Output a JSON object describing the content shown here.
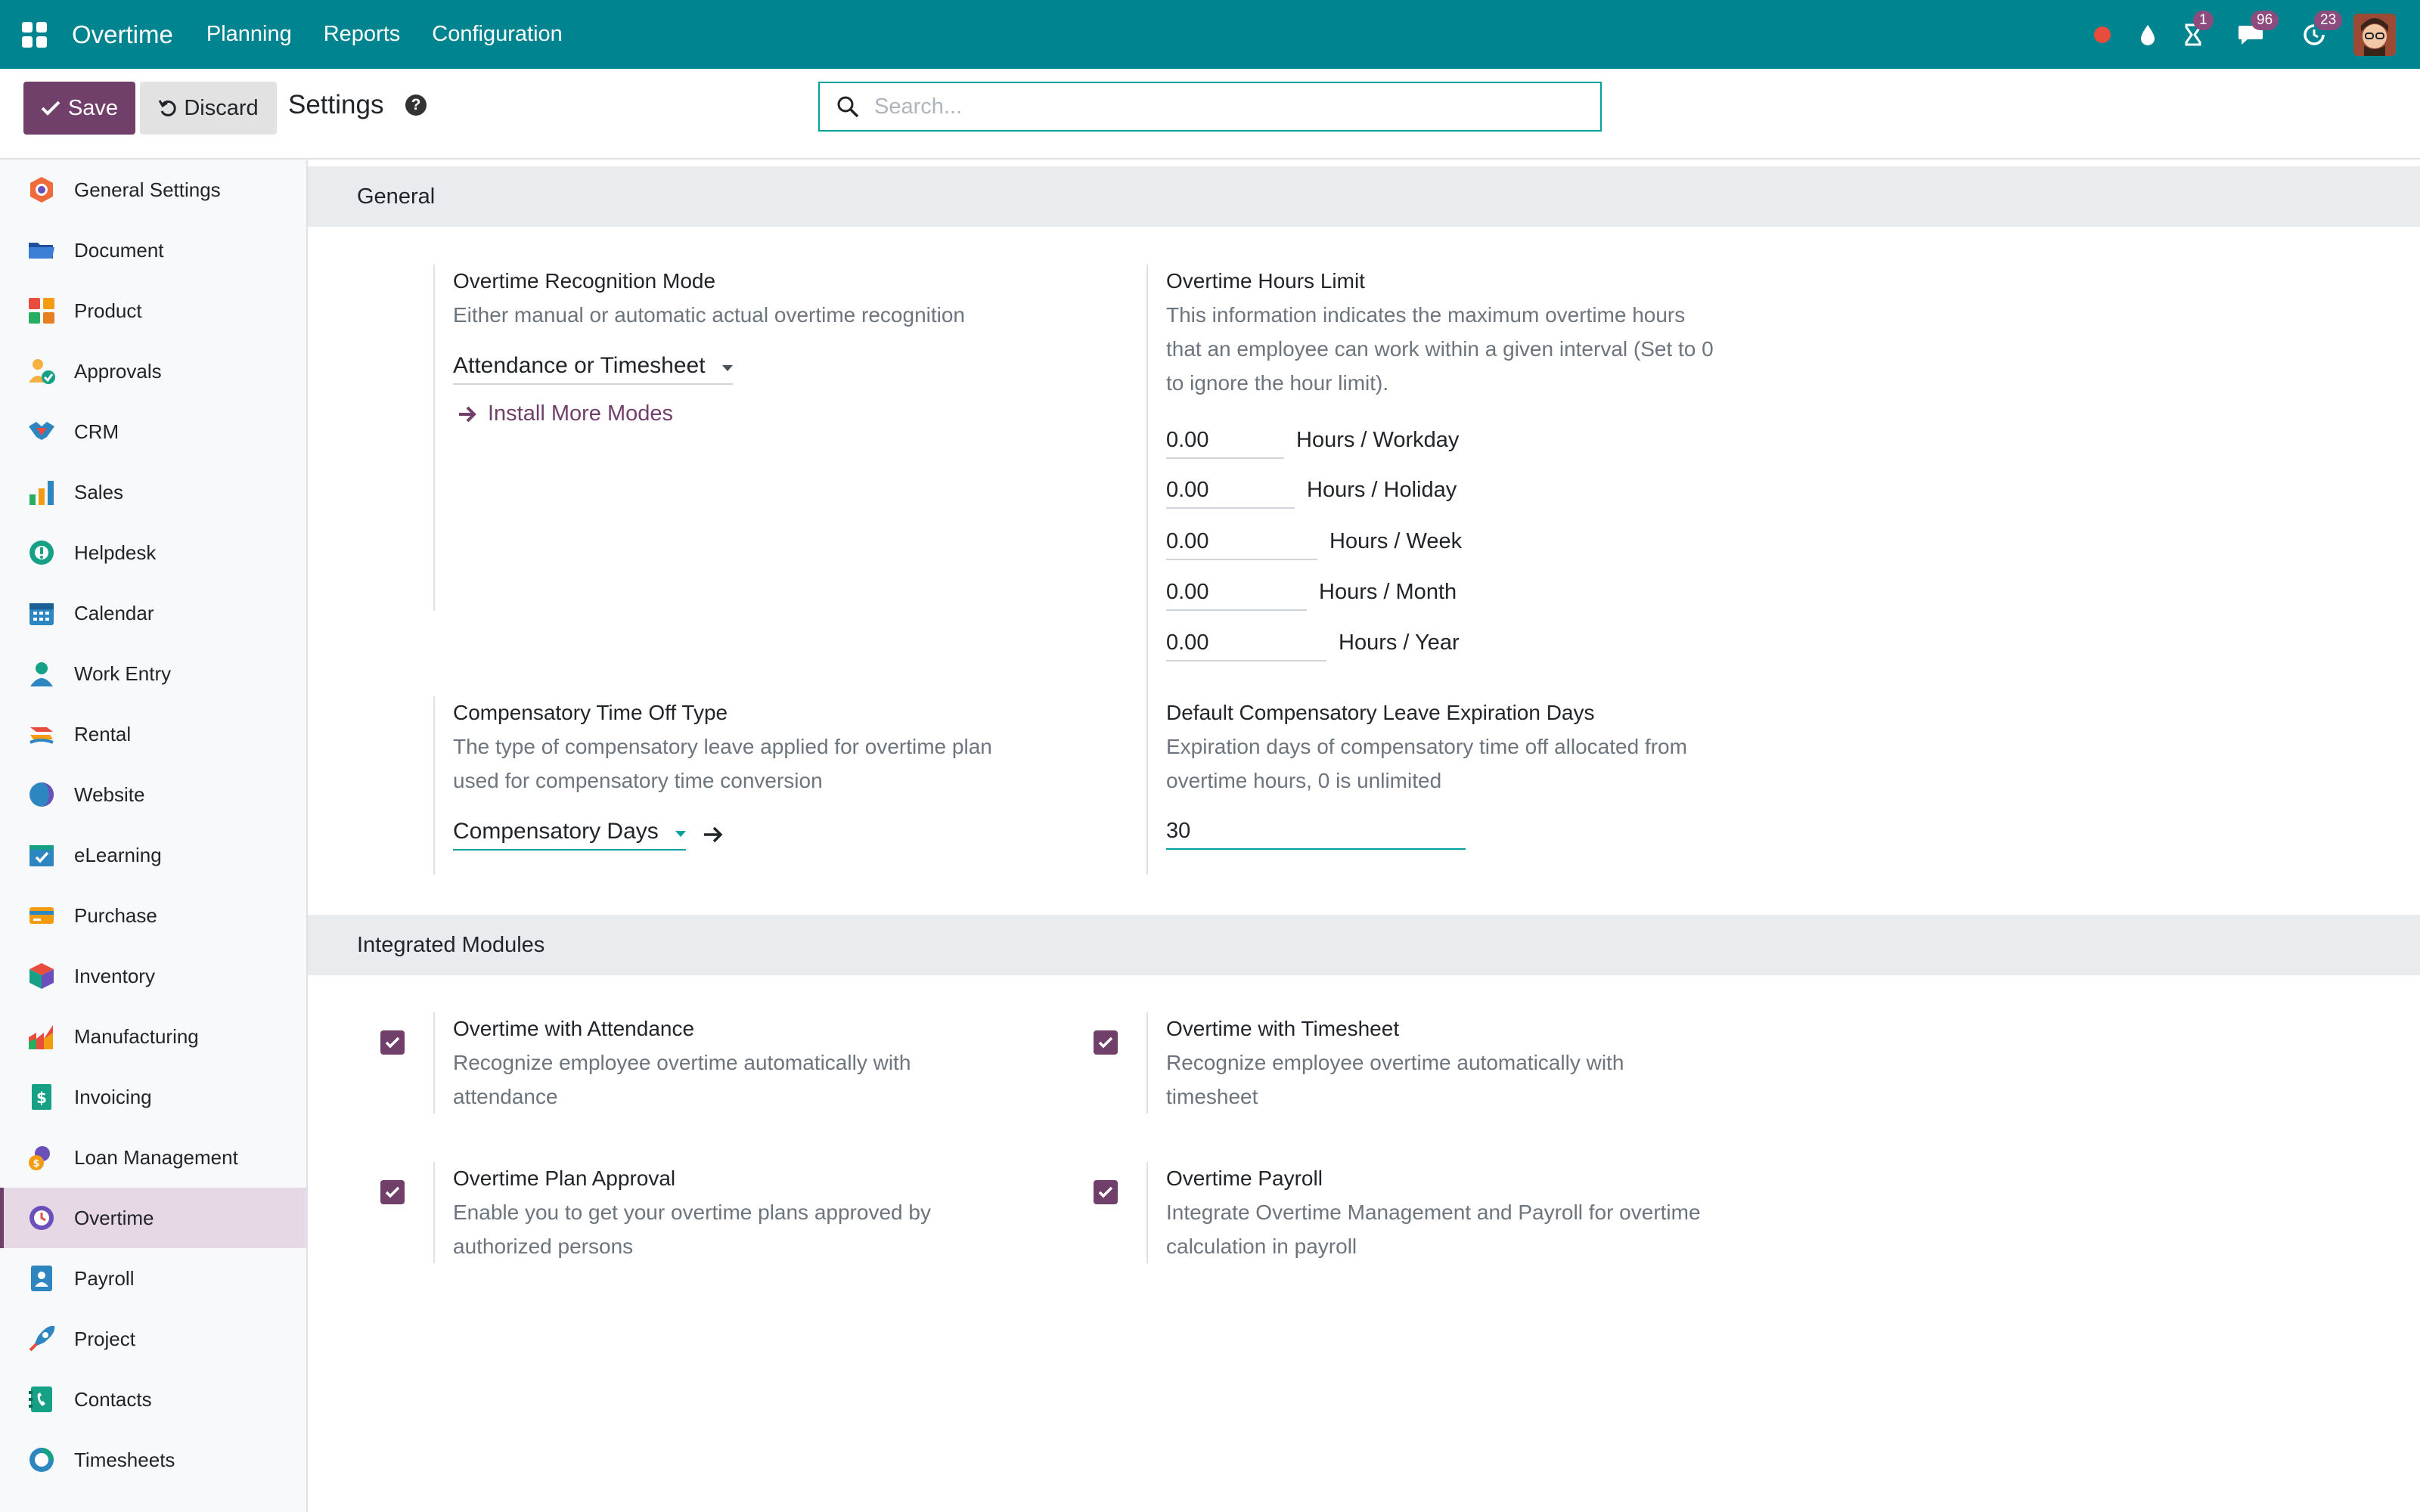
{
  "app": {
    "name": "Overtime",
    "menu": [
      "Planning",
      "Reports",
      "Configuration"
    ]
  },
  "systray": {
    "activity_count": "1",
    "messages_count": "96",
    "updates_count": "23"
  },
  "toolbar": {
    "save_label": "Save",
    "discard_label": "Discard",
    "title": "Settings"
  },
  "search": {
    "placeholder": "Search...",
    "value": ""
  },
  "sidebar": {
    "active": "Overtime",
    "items": [
      {
        "label": "General Settings",
        "icon": "general-settings-icon"
      },
      {
        "label": "Document",
        "icon": "document-icon"
      },
      {
        "label": "Product",
        "icon": "product-icon"
      },
      {
        "label": "Approvals",
        "icon": "approvals-icon"
      },
      {
        "label": "CRM",
        "icon": "crm-icon"
      },
      {
        "label": "Sales",
        "icon": "sales-icon"
      },
      {
        "label": "Helpdesk",
        "icon": "helpdesk-icon"
      },
      {
        "label": "Calendar",
        "icon": "calendar-icon"
      },
      {
        "label": "Work Entry",
        "icon": "work-entry-icon"
      },
      {
        "label": "Rental",
        "icon": "rental-icon"
      },
      {
        "label": "Website",
        "icon": "website-icon"
      },
      {
        "label": "eLearning",
        "icon": "elearning-icon"
      },
      {
        "label": "Purchase",
        "icon": "purchase-icon"
      },
      {
        "label": "Inventory",
        "icon": "inventory-icon"
      },
      {
        "label": "Manufacturing",
        "icon": "manufacturing-icon"
      },
      {
        "label": "Invoicing",
        "icon": "invoicing-icon"
      },
      {
        "label": "Loan Management",
        "icon": "loan-management-icon"
      },
      {
        "label": "Overtime",
        "icon": "overtime-icon"
      },
      {
        "label": "Payroll",
        "icon": "payroll-icon"
      },
      {
        "label": "Project",
        "icon": "project-icon"
      },
      {
        "label": "Contacts",
        "icon": "contacts-icon"
      },
      {
        "label": "Timesheets",
        "icon": "timesheets-icon"
      }
    ]
  },
  "general": {
    "title": "General",
    "recognition_mode": {
      "title": "Overtime Recognition Mode",
      "desc": "Either manual or automatic actual overtime recognition",
      "value": "Attendance or Timesheet",
      "install_more": "Install More Modes"
    },
    "hours_limit": {
      "title": "Overtime Hours Limit",
      "desc1": "This information indicates the maximum overtime hours",
      "desc2": "that an employee can work within a given interval (Set to 0",
      "desc3": "to ignore the hour limit).",
      "rows": [
        {
          "value": "0.00",
          "label": "Hours / Workday"
        },
        {
          "value": "0.00",
          "label": "Hours / Holiday"
        },
        {
          "value": "0.00",
          "label": "Hours / Week"
        },
        {
          "value": "0.00",
          "label": "Hours / Month"
        },
        {
          "value": "0.00",
          "label": "Hours / Year"
        }
      ]
    },
    "comp_type": {
      "title": "Compensatory Time Off Type",
      "desc1": "The type of compensatory leave applied for overtime plan",
      "desc2": "used for compensatory time conversion",
      "value": "Compensatory Days"
    },
    "expiration": {
      "title": "Default Compensatory Leave Expiration Days",
      "desc1": "Expiration days of compensatory time off allocated from",
      "desc2": "overtime hours, 0 is unlimited",
      "value": "30"
    }
  },
  "modules": {
    "title": "Integrated Modules",
    "items": [
      {
        "title": "Overtime with Attendance",
        "desc1": "Recognize employee overtime automatically with",
        "desc2": "attendance",
        "checked": true
      },
      {
        "title": "Overtime with Timesheet",
        "desc1": "Recognize employee overtime automatically with",
        "desc2": "timesheet",
        "checked": true
      },
      {
        "title": "Overtime Plan Approval",
        "desc1": "Enable you to get your overtime plans approved by",
        "desc2": "authorized persons",
        "checked": true
      },
      {
        "title": "Overtime Payroll",
        "desc1": "Integrate Overtime Management and Payroll for overtime",
        "desc2": "calculation in payroll",
        "checked": true
      }
    ]
  },
  "colors": {
    "navbar": "#00848f",
    "primary": "#71406a",
    "accent": "#00a09d"
  }
}
